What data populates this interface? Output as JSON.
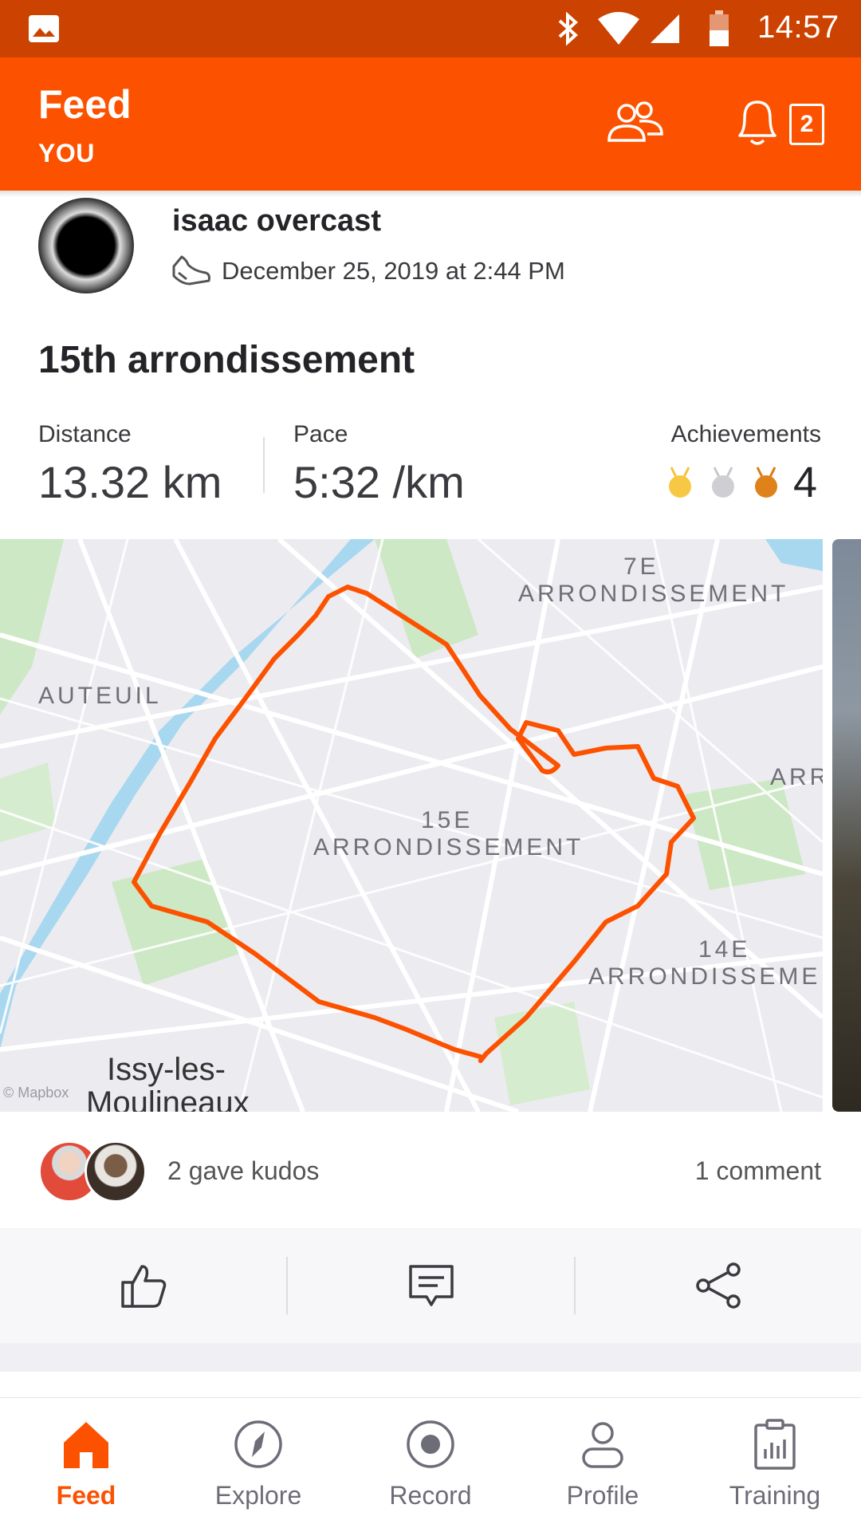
{
  "status_bar": {
    "time": "14:57",
    "icons": [
      "gallery-icon",
      "bluetooth-icon",
      "wifi-icon",
      "signal-icon",
      "battery-icon"
    ]
  },
  "header": {
    "title": "Feed",
    "subtitle": "YOU",
    "notification_count": "2",
    "accent": "#fc5200"
  },
  "activity": {
    "athlete_name": "isaac overcast",
    "date": "December 25, 2019 at 2:44 PM",
    "title": "15th arrondissement",
    "stats": {
      "distance_label": "Distance",
      "distance_value": "13.32 km",
      "pace_label": "Pace",
      "pace_value": "5:32 /km",
      "achievements_label": "Achievements",
      "achievements_count": "4"
    },
    "map_labels": {
      "a7": "7E",
      "a7b": "ARRONDISSEMENT",
      "auteuil": "AUTEUIL",
      "arr": "ARR",
      "a15": "15E",
      "a15b": "ARRONDISSEMENT",
      "a14": "14E",
      "a14b": "ARRONDISSEMEI",
      "issy1": "Issy-les-",
      "issy2": "Moulineaux",
      "attribution": "© Mapbox"
    },
    "kudos_text": "2 gave kudos",
    "comments_text": "1 comment"
  },
  "nav": [
    {
      "label": "Feed",
      "icon": "home-icon",
      "active": true
    },
    {
      "label": "Explore",
      "icon": "compass-icon",
      "active": false
    },
    {
      "label": "Record",
      "icon": "record-icon",
      "active": false
    },
    {
      "label": "Profile",
      "icon": "profile-icon",
      "active": false
    },
    {
      "label": "Training",
      "icon": "training-icon",
      "active": false
    }
  ]
}
